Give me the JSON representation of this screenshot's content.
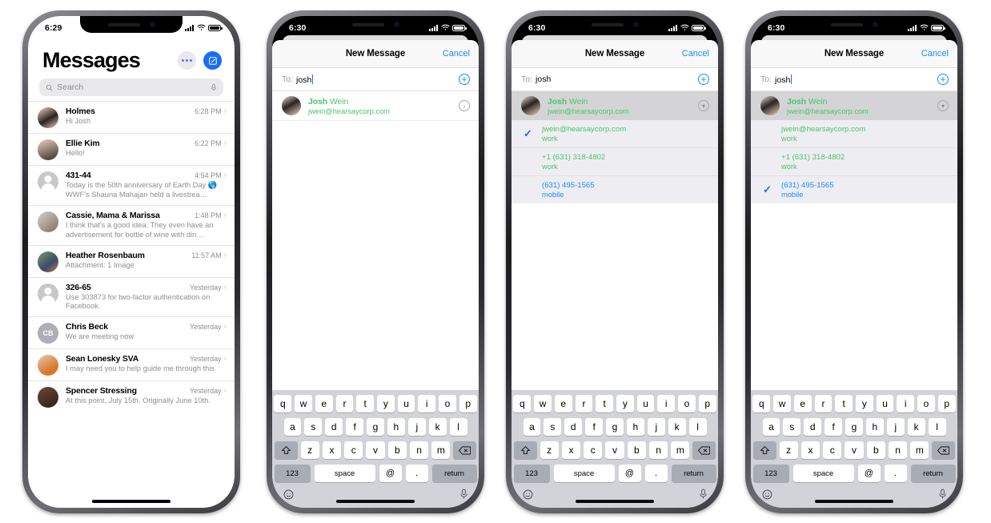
{
  "phones": [
    {
      "status": {
        "time": "6:29",
        "signal": "cellular-bars",
        "wifi": "wifi-icon",
        "battery": "battery-full-icon"
      },
      "app": {
        "title": "Messages",
        "more_label": "•••",
        "compose_label": "compose-icon",
        "search": {
          "placeholder": "Search",
          "icon": "search-icon",
          "mic": "microphone-icon"
        },
        "conversations": [
          {
            "name": "Holmes",
            "time": "6:28 PM",
            "preview": "Hi Josh",
            "avatar": "photo",
            "initials": ""
          },
          {
            "name": "Ellie Kim",
            "time": "6:22 PM",
            "preview": "Hello!",
            "avatar": "photo",
            "initials": ""
          },
          {
            "name": "431-44",
            "time": "4:54 PM",
            "preview": "Today is the 50th anniversary of Earth Day 🌎 WWF's Shauna Mahajan held a livestrea…",
            "avatar": "generic",
            "initials": ""
          },
          {
            "name": "Cassie, Mama & Marissa",
            "time": "1:48 PM",
            "preview": "I think that's a good idea.   They even have an advertisement for bottle of wine with din…",
            "avatar": "photo",
            "initials": ""
          },
          {
            "name": "Heather Rosenbaum",
            "time": "11:57 AM",
            "preview": "Attachment: 1 Image",
            "avatar": "photo",
            "initials": ""
          },
          {
            "name": "326-65",
            "time": "Yesterday",
            "preview": "Use 303873 for two-factor authentication on Facebook.",
            "avatar": "generic",
            "initials": ""
          },
          {
            "name": "Chris Beck",
            "time": "Yesterday",
            "preview": "We are meeting now",
            "avatar": "initials",
            "initials": "CB"
          },
          {
            "name": "Sean Lonesky SVA",
            "time": "Yesterday",
            "preview": "I may need you to help guide me through this",
            "avatar": "photo",
            "initials": ""
          },
          {
            "name": "Spencer Stressing",
            "time": "Yesterday",
            "preview": "At this point, July 15th. Originally June 10th.",
            "avatar": "photo",
            "initials": ""
          }
        ]
      }
    },
    {
      "status": {
        "time": "6:30"
      },
      "sheet": {
        "nav_title": "New Message",
        "cancel_label": "Cancel",
        "to_label": "To:",
        "to_value": "josh",
        "add_contact_icon": "plus-circle-icon",
        "contact": {
          "first_name": "Josh",
          "last_name": "Wein",
          "subtitle": "jwein@hearsaycorp.com",
          "disclosure_icon": "chevron-right-circle-icon",
          "selected": false,
          "expanded": false
        },
        "details": []
      }
    },
    {
      "status": {
        "time": "6:30"
      },
      "sheet": {
        "nav_title": "New Message",
        "cancel_label": "Cancel",
        "to_label": "To:",
        "to_value": "josh",
        "add_contact_icon": "plus-circle-icon",
        "contact": {
          "first_name": "Josh",
          "last_name": "Wein",
          "subtitle": "jwein@hearsaycorp.com",
          "disclosure_icon": "chevron-down-circle-icon",
          "selected": true,
          "expanded": true
        },
        "details": [
          {
            "value": "jwein@hearsaycorp.com",
            "label": "work",
            "color": "green",
            "checked": true
          },
          {
            "value": "+1 (631) 318-4802",
            "label": "work",
            "color": "green",
            "checked": false
          },
          {
            "value": "(631) 495-1565",
            "label": "mobile",
            "color": "blue",
            "checked": false
          }
        ]
      }
    },
    {
      "status": {
        "time": "6:30"
      },
      "sheet": {
        "nav_title": "New Message",
        "cancel_label": "Cancel",
        "to_label": "To:",
        "to_value": "josh",
        "add_contact_icon": "plus-circle-icon",
        "contact": {
          "first_name": "Josh",
          "last_name": "Wein",
          "subtitle": "jwein@hearsaycorp.com",
          "disclosure_icon": "chevron-down-circle-icon",
          "selected": true,
          "expanded": true
        },
        "details": [
          {
            "value": "jwein@hearsaycorp.com",
            "label": "work",
            "color": "green",
            "checked": false
          },
          {
            "value": "+1 (631) 318-4802",
            "label": "work",
            "color": "green",
            "checked": false
          },
          {
            "value": "(631) 495-1565",
            "label": "mobile",
            "color": "blue",
            "checked": true
          }
        ]
      }
    }
  ],
  "keyboard": {
    "row1": [
      "q",
      "w",
      "e",
      "r",
      "t",
      "y",
      "u",
      "i",
      "o",
      "p"
    ],
    "row2": [
      "a",
      "s",
      "d",
      "f",
      "g",
      "h",
      "j",
      "k",
      "l"
    ],
    "row3": [
      "z",
      "x",
      "c",
      "v",
      "b",
      "n",
      "m"
    ],
    "shift_icon": "shift-icon",
    "delete_icon": "backspace-icon",
    "numbers_label": "123",
    "space_label": "space",
    "at_label": "@",
    "dot_label": ".",
    "return_label": "return",
    "emoji_icon": "emoji-icon",
    "dictation_icon": "microphone-icon"
  },
  "colors": {
    "accent_blue": "#1a8cff",
    "compose_blue": "#1a6cf5",
    "contact_green": "#4cc469",
    "gray_text": "#8e8e93",
    "keyboard_bg": "#d1d3d9",
    "key_gray": "#a8acb5",
    "selected_row": "#d4d4d6",
    "detail_bg": "#eeeef2"
  }
}
